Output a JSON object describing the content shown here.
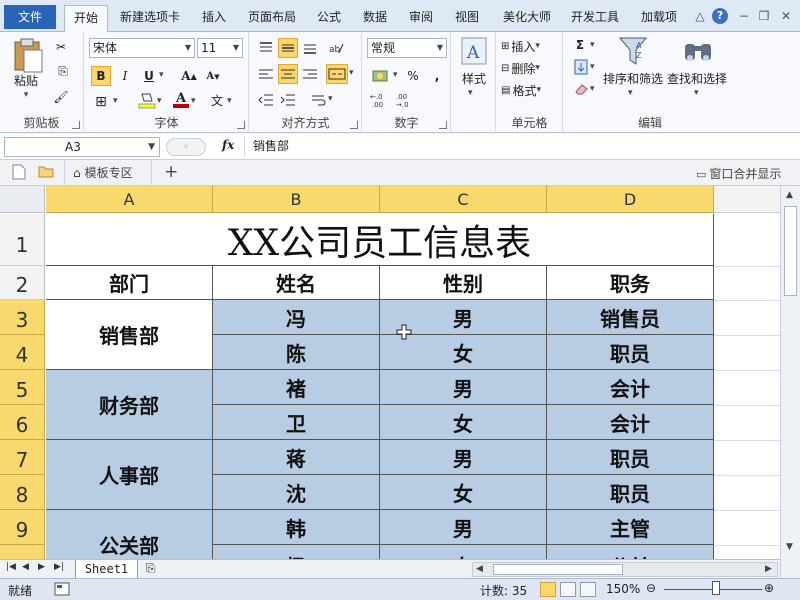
{
  "ribbon_tabs": {
    "file": "文件",
    "tabs": [
      "开始",
      "新建选项卡",
      "插入",
      "页面布局",
      "公式",
      "数据",
      "审阅",
      "视图",
      "美化大师",
      "开发工具",
      "加载项"
    ],
    "active": "开始"
  },
  "clipboard": {
    "paste": "粘贴",
    "label": "剪贴板"
  },
  "font": {
    "name": "宋体",
    "size": "11",
    "label": "字体",
    "bold": "B",
    "italic": "I",
    "underline": "U",
    "grow": "A",
    "shrink": "A",
    "fill_color": "#ffff00",
    "font_color": "#c00000"
  },
  "alignment": {
    "label": "对齐方式"
  },
  "number": {
    "format": "常规",
    "label": "数字",
    "percent": "%",
    "comma": ","
  },
  "styles": {
    "label": "样式"
  },
  "cells": {
    "insert": "插入",
    "delete": "删除",
    "format": "格式",
    "label": "单元格"
  },
  "editing": {
    "sigma": "Σ",
    "sort_filter": "排序和筛选",
    "find_select": "查找和选择",
    "label": "编辑"
  },
  "formula_bar": {
    "name_box": "A3",
    "fx": "fx",
    "content": "销售部"
  },
  "tab_strip": {
    "template_zone": "模板专区",
    "add": "+",
    "merge_windows": "窗口合并显示"
  },
  "columns": [
    "A",
    "B",
    "C",
    "D"
  ],
  "rows": [
    "1",
    "2",
    "3",
    "4",
    "5",
    "6",
    "7",
    "8",
    "9"
  ],
  "sheet": {
    "title": "XX公司员工信息表",
    "headers": [
      "部门",
      "姓名",
      "性别",
      "职务"
    ],
    "departments": [
      "销售部",
      "财务部",
      "人事部",
      "公关部"
    ],
    "data": [
      [
        "冯",
        "男",
        "销售员"
      ],
      [
        "陈",
        "女",
        "职员"
      ],
      [
        "褚",
        "男",
        "会计"
      ],
      [
        "卫",
        "女",
        "会计"
      ],
      [
        "蒋",
        "男",
        "职员"
      ],
      [
        "沈",
        "女",
        "职员"
      ],
      [
        "韩",
        "男",
        "主管"
      ],
      [
        "杨",
        "女",
        "公关"
      ]
    ]
  },
  "sheet_tabs": {
    "active": "Sheet1"
  },
  "status_bar": {
    "mode": "就绪",
    "count": "计数: 35",
    "zoom": "150%"
  },
  "colors": {
    "selection": "#b8cce4",
    "header_highlight": "#f8d96e",
    "file_tab": "#2a64b4"
  }
}
